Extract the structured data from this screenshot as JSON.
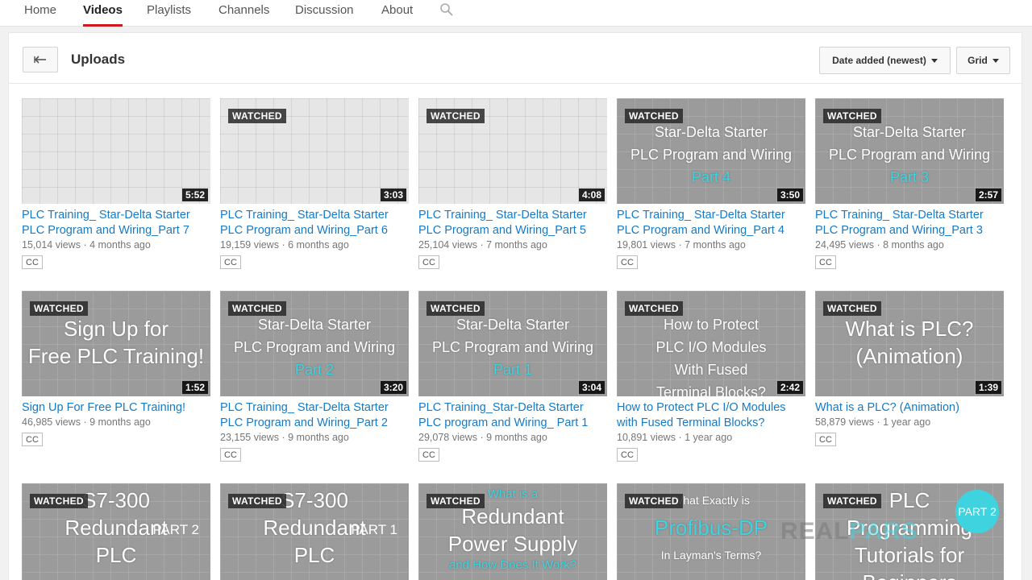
{
  "nav": {
    "tabs": [
      "Home",
      "Videos",
      "Playlists",
      "Channels",
      "Discussion",
      "About"
    ],
    "active": "Videos"
  },
  "header": {
    "title": "Uploads",
    "sort_label": "Date added (newest)",
    "view_label": "Grid"
  },
  "videos": [
    {
      "title": "PLC Training_ Star-Delta Starter PLC Program and Wiring_Part 7",
      "views": "15,014 views",
      "age": "4 months ago",
      "duration": "5:52",
      "watched": "",
      "cc": "CC",
      "thumb_lines": []
    },
    {
      "title": "PLC Training_ Star-Delta Starter PLC Program and Wiring_Part 6",
      "views": "19,159 views",
      "age": "6 months ago",
      "duration": "3:03",
      "watched": "WATCHED",
      "cc": "CC",
      "thumb_lines": []
    },
    {
      "title": "PLC Training_ Star-Delta Starter PLC Program and Wiring_Part 5",
      "views": "25,104 views",
      "age": "7 months ago",
      "duration": "4:08",
      "watched": "WATCHED",
      "cc": "CC",
      "thumb_lines": []
    },
    {
      "title": "PLC Training_ Star-Delta Starter PLC Program and Wiring_Part 4",
      "views": "19,801 views",
      "age": "7 months ago",
      "duration": "3:50",
      "watched": "WATCHED",
      "cc": "CC",
      "thumb_lines": [
        "Star-Delta Starter",
        "PLC Program and Wiring",
        "Part 4"
      ]
    },
    {
      "title": "PLC Training_ Star-Delta Starter PLC Program and Wiring_Part 3",
      "views": "24,495 views",
      "age": "8 months ago",
      "duration": "2:57",
      "watched": "WATCHED",
      "cc": "CC",
      "thumb_lines": [
        "Star-Delta Starter",
        "PLC Program and Wiring",
        "Part 3"
      ]
    },
    {
      "title": "Sign Up For Free PLC Training!",
      "views": "46,985 views",
      "age": "9 months ago",
      "duration": "1:52",
      "watched": "WATCHED",
      "cc": "CC",
      "thumb_lines": [
        "Sign Up for",
        "Free PLC Training!"
      ]
    },
    {
      "title": "PLC Training_ Star-Delta Starter PLC Program and Wiring_Part 2",
      "views": "23,155 views",
      "age": "9 months ago",
      "duration": "3:20",
      "watched": "WATCHED",
      "cc": "CC",
      "thumb_lines": [
        "Star-Delta Starter",
        "PLC Program and Wiring",
        "Part 2"
      ]
    },
    {
      "title": "PLC Training_Star-Delta Starter PLC program and Wiring_ Part 1",
      "views": "29,078 views",
      "age": "9 months ago",
      "duration": "3:04",
      "watched": "WATCHED",
      "cc": "CC",
      "thumb_lines": [
        "Star-Delta Starter",
        "PLC Program and Wiring",
        "Part 1"
      ]
    },
    {
      "title": "How to Protect PLC I/O Modules with Fused Terminal Blocks?",
      "views": "10,891 views",
      "age": "1 year ago",
      "duration": "2:42",
      "watched": "WATCHED",
      "cc": "CC",
      "thumb_lines": [
        "How to Protect",
        "PLC I/O Modules",
        "With Fused",
        "Terminal Blocks?"
      ]
    },
    {
      "title": "What is a PLC? (Animation)",
      "views": "58,879 views",
      "age": "1 year ago",
      "duration": "1:39",
      "watched": "WATCHED",
      "cc": "CC",
      "thumb_lines": [
        "What is PLC?",
        "(Animation)"
      ]
    },
    {
      "title": "",
      "views": "",
      "age": "",
      "duration": "",
      "watched": "WATCHED",
      "cc": "",
      "thumb_lines": [
        "S7-300",
        "Redundant",
        "PLC"
      ],
      "badge": "PART 2"
    },
    {
      "title": "",
      "views": "",
      "age": "",
      "duration": "",
      "watched": "WATCHED",
      "cc": "",
      "thumb_lines": [
        "S7-300",
        "Redundant",
        "PLC"
      ],
      "badge": "PART 1"
    },
    {
      "title": "",
      "views": "",
      "age": "",
      "duration": "",
      "watched": "WATCHED",
      "cc": "",
      "thumb_lines": [
        "What is a",
        "Redundant",
        "Power Supply",
        "and How Does It Work?"
      ]
    },
    {
      "title": "",
      "views": "",
      "age": "",
      "duration": "",
      "watched": "WATCHED",
      "cc": "",
      "thumb_lines": [
        "What Exactly is",
        "Profibus-DP",
        "In Layman's Terms?"
      ]
    },
    {
      "title": "",
      "views": "",
      "age": "",
      "duration": "",
      "watched": "WATCHED",
      "cc": "",
      "thumb_lines": [
        "PLC",
        "Programming",
        "Tutorials for",
        "Beginners"
      ],
      "badge": "PART 2"
    }
  ],
  "watermark": {
    "left": "REAL",
    "right": "PARS"
  },
  "colors": {
    "link": "#167ac6",
    "accent": "#cc181e",
    "cyan": "#3fd3e0"
  }
}
